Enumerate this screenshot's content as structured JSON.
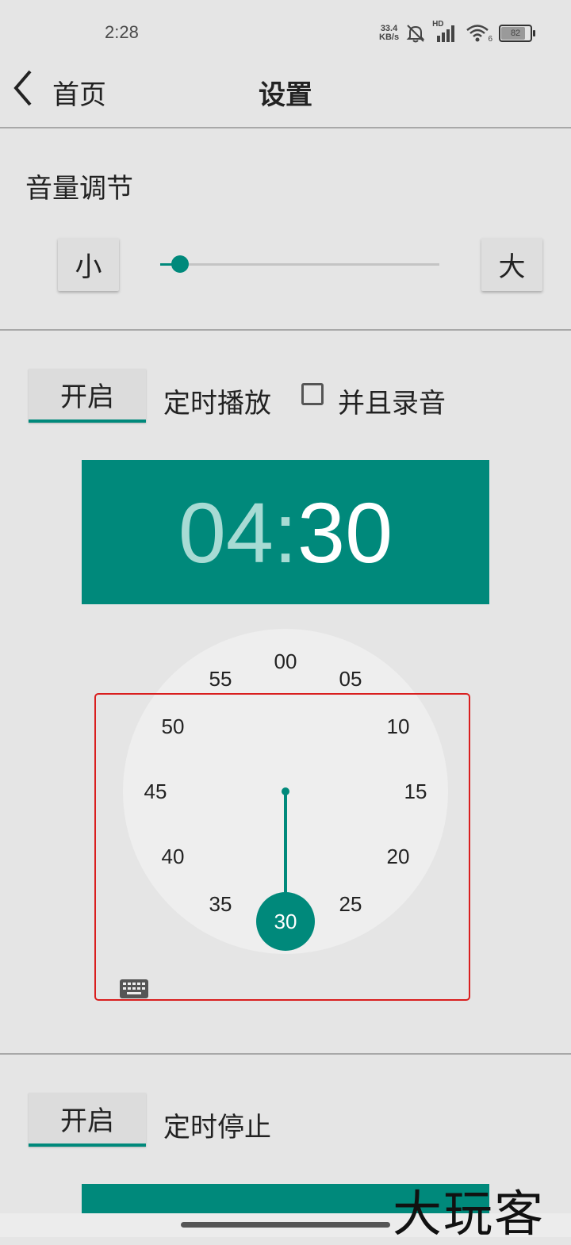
{
  "status_bar": {
    "time": "2:28",
    "net_speed_value": "33.4",
    "net_speed_unit": "KB/s",
    "network_type": "HD",
    "wifi_badge": "6",
    "battery_level": "82"
  },
  "header": {
    "back_label": "首页",
    "title": "设置"
  },
  "volume": {
    "title": "音量调节",
    "decrease_label": "小",
    "increase_label": "大",
    "level": 0.07
  },
  "scheduled_play": {
    "toggle_label": "开启",
    "label": "定时播放",
    "checkbox_label": "并且录音",
    "checkbox_checked": false,
    "time_hour": "04",
    "time_sep": ":",
    "time_minute": "30",
    "minute_marks": [
      "00",
      "05",
      "10",
      "15",
      "20",
      "25",
      "30",
      "35",
      "40",
      "45",
      "50",
      "55"
    ],
    "selected_minute": "30"
  },
  "scheduled_stop": {
    "toggle_label": "开启",
    "label": "定时停止"
  },
  "watermark": "大玩客",
  "colors": {
    "accent": "#00897b",
    "background": "#e5e5e5",
    "highlight": "#d91e1e"
  }
}
